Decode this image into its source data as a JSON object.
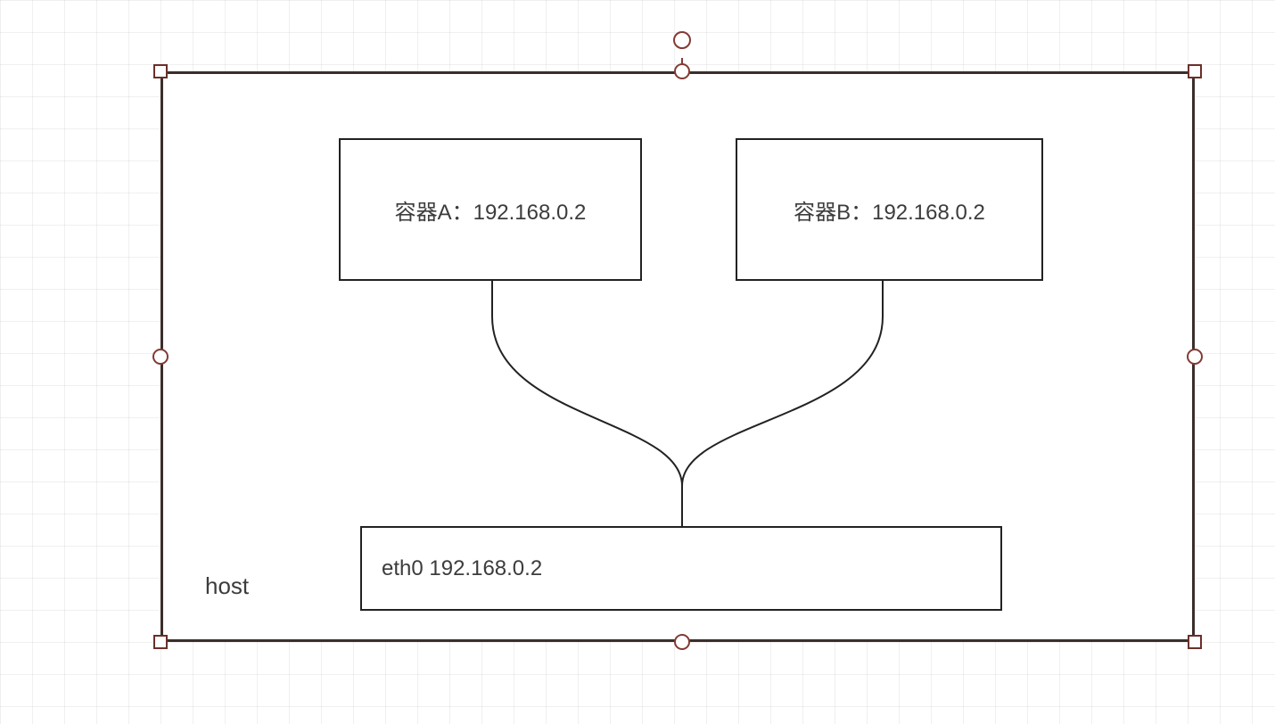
{
  "host": {
    "label": "host"
  },
  "containerA": {
    "label": "容器A：192.168.0.2"
  },
  "containerB": {
    "label": "容器B：192.168.0.2"
  },
  "eth0": {
    "label": "eth0 192.168.0.2"
  },
  "layout": {
    "selection_border_color": "#3b2e2a",
    "handle_color": "#833a34",
    "grid_color": "rgba(0,0,0,0.06)"
  }
}
